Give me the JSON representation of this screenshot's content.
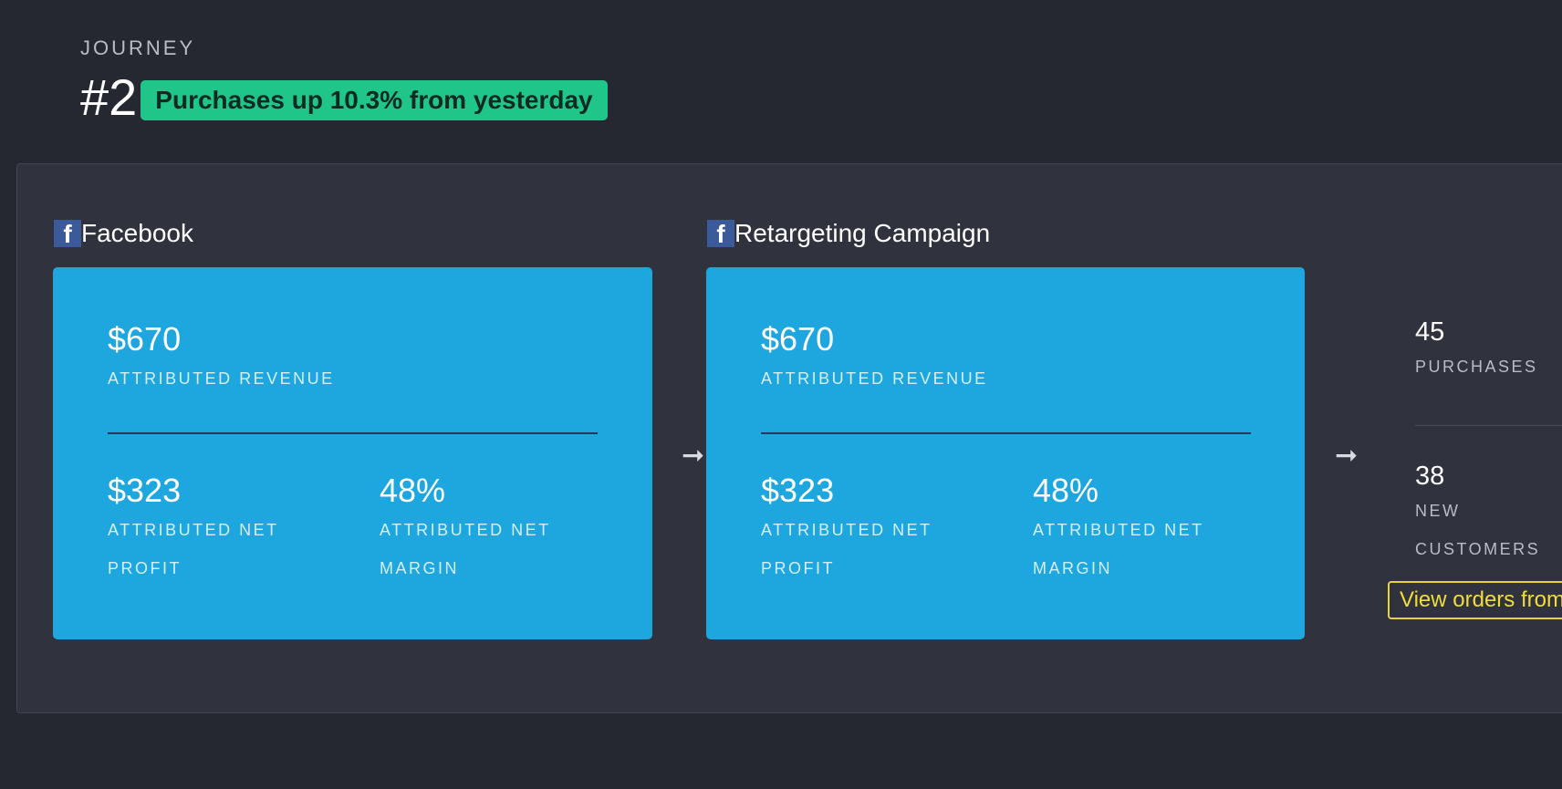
{
  "header": {
    "eyebrow": "JOURNEY",
    "number": "#2",
    "badge": "Purchases up 10.3% from yesterday"
  },
  "steps": [
    {
      "source_icon": "facebook-icon",
      "title": "Facebook",
      "revenue_value": "$670",
      "revenue_label": "ATTRIBUTED REVENUE",
      "profit_value": "$323",
      "profit_label_1": "ATTRIBUTED NET",
      "profit_label_2": "PROFIT",
      "margin_value": "48%",
      "margin_label_1": "ATTRIBUTED NET",
      "margin_label_2": "MARGIN"
    },
    {
      "source_icon": "facebook-icon",
      "title": "Retargeting Campaign",
      "revenue_value": "$670",
      "revenue_label": "ATTRIBUTED REVENUE",
      "profit_value": "$323",
      "profit_label_1": "ATTRIBUTED NET",
      "profit_label_2": "PROFIT",
      "margin_value": "48%",
      "margin_label_1": "ATTRIBUTED NET",
      "margin_label_2": "MARGIN"
    }
  ],
  "arrow_glyph": "➞",
  "summary": {
    "purchases_value": "45",
    "purchases_label": "PURCHASES",
    "customers_value": "38",
    "customers_label_1": "NEW",
    "customers_label_2": "CUSTOMERS",
    "orders_link": "View orders from"
  },
  "colors": {
    "background": "#252831",
    "panel": "#30333e",
    "card": "#1ea7de",
    "badge": "#20c58a",
    "link": "#f0dc3c",
    "facebook": "#3b5a9a"
  }
}
